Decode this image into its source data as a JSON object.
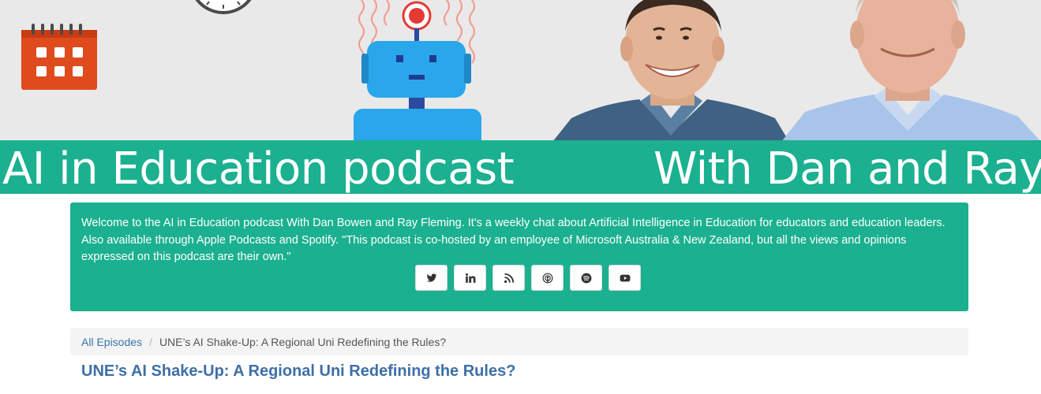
{
  "banner": {
    "title_left": "AI in Education podcast",
    "title_right": "With Dan and Ray",
    "accent_color": "#1bb08f",
    "illustrations": [
      "clock-icon",
      "calendar-icon",
      "robot-icon"
    ],
    "photos": [
      "host-photo-dan",
      "host-photo-ray"
    ]
  },
  "intro": {
    "text": "Welcome to the AI in Education podcast With Dan Bowen and Ray Fleming. It's a weekly chat about Artificial Intelligence in Education for educators and education leaders. Also available through Apple Podcasts and Spotify. \"This podcast is co-hosted by an employee of Microsoft Australia & New Zealand, but all the views and opinions expressed on this podcast are their own.\"",
    "social_links": [
      {
        "icon": "twitter-icon"
      },
      {
        "icon": "linkedin-icon"
      },
      {
        "icon": "rss-icon"
      },
      {
        "icon": "apple-podcasts-icon"
      },
      {
        "icon": "spotify-icon"
      },
      {
        "icon": "youtube-icon"
      }
    ]
  },
  "breadcrumb": {
    "home_label": "All Episodes",
    "separator": "/",
    "current_label": "UNE’s AI Shake-Up: A Regional Uni Redefining the Rules?"
  },
  "episode": {
    "title": "UNE’s AI Shake-Up: A Regional Uni Redefining the Rules?"
  }
}
